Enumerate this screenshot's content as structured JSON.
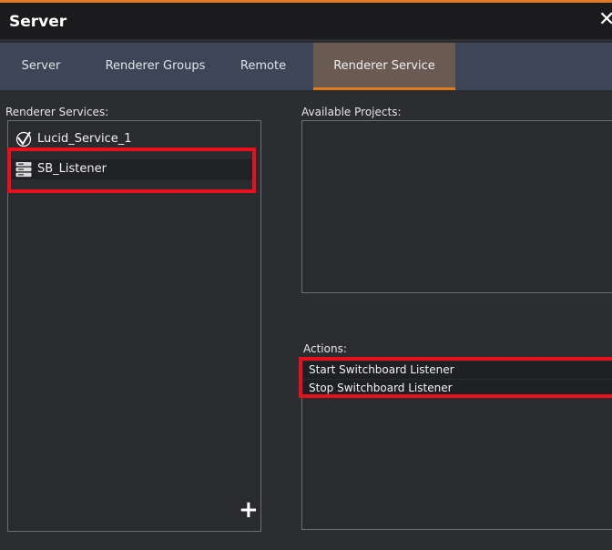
{
  "window": {
    "title": "Server",
    "close_glyph": "✕"
  },
  "tabs": [
    {
      "label": "Server"
    },
    {
      "label": "Renderer Groups"
    },
    {
      "label": "Remote"
    },
    {
      "label": "Renderer Service",
      "active": true
    }
  ],
  "renderer_services": {
    "label": "Renderer Services:",
    "items": [
      {
        "label": "Lucid_Service_1",
        "icon": "checkmark-service-icon"
      },
      {
        "label": "SB_Listener",
        "icon": "server-stack-icon",
        "selected": true
      }
    ],
    "add_glyph": "+"
  },
  "available_projects": {
    "label": "Available Projects:"
  },
  "actions": {
    "label": "Actions:",
    "items": [
      {
        "label": "Start Switchboard Listener"
      },
      {
        "label": "Stop Switchboard Listener"
      }
    ]
  },
  "colors": {
    "accent": "#e07a1f",
    "highlight": "#e8101c",
    "tabbar": "#3c4656",
    "active_tab": "#6a5b52"
  }
}
